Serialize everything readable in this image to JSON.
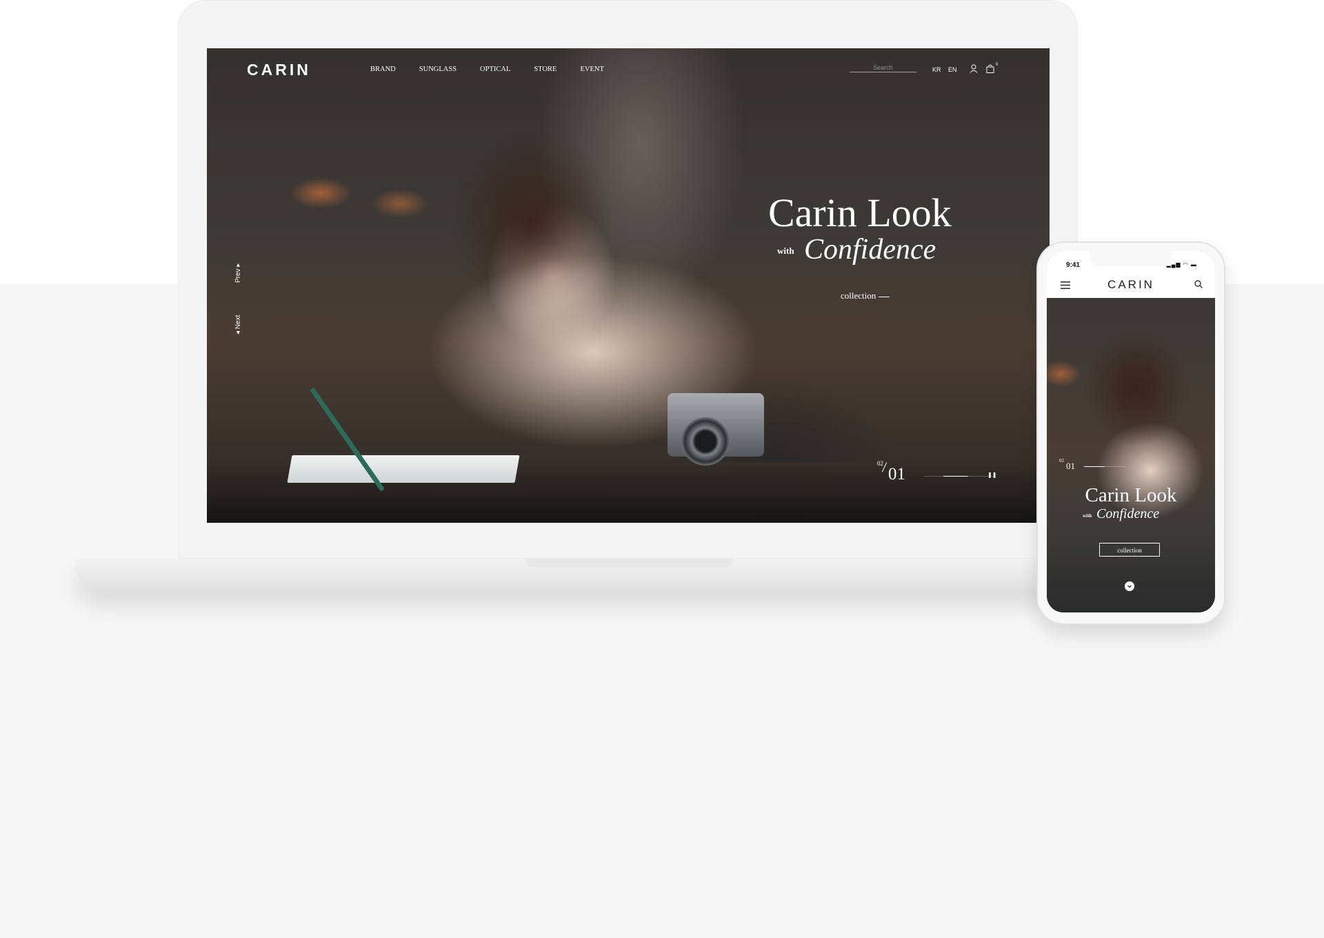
{
  "desktop": {
    "logo": "CARIN",
    "nav": [
      "BRAND",
      "SUNGLASS",
      "OPTICAL",
      "STORE",
      "EVENT"
    ],
    "search_placeholder": "Search",
    "languages": [
      "KR",
      "EN"
    ],
    "cart_count": "0",
    "slider_controls": {
      "prev": "Prev",
      "next": "Next"
    },
    "hero": {
      "title": "Carin Look",
      "with": "with",
      "subtitle": "Confidence",
      "link": "collection"
    },
    "slide_counter": {
      "total": "02",
      "current": "01",
      "progress": 0.5
    }
  },
  "mobile": {
    "status_time": "9:41",
    "logo": "CARIN",
    "hero": {
      "title": "Carin Look",
      "with": "with",
      "subtitle": "Confidence",
      "button": "collection"
    },
    "slide_counter": {
      "total": "02",
      "current": "01",
      "progress": 0.5
    }
  },
  "colors": {
    "hero_text": "#ffffff",
    "page_bg": "#f6f6f6",
    "device_frame": "#f4f4f4"
  }
}
